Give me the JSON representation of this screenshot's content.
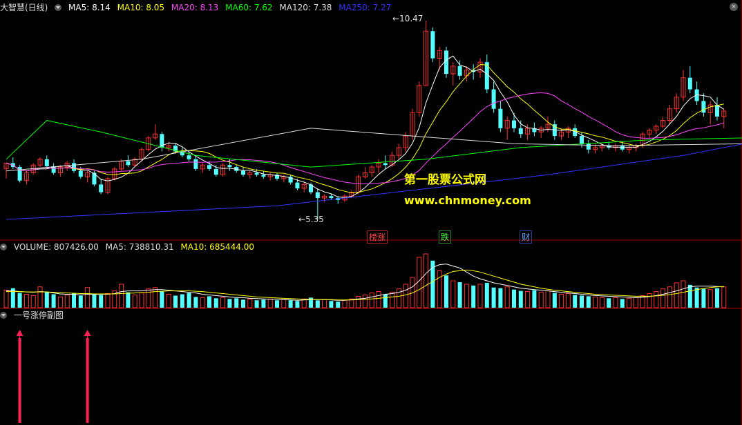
{
  "main": {
    "title": "大智慧(日线)",
    "ma": [
      {
        "label": "MA5: 8.14",
        "color": "#ffffff"
      },
      {
        "label": "MA10: 8.05",
        "color": "#ffff00"
      },
      {
        "label": "MA20: 8.13",
        "color": "#ff44ff"
      },
      {
        "label": "MA60: 7.62",
        "color": "#00ff00"
      },
      {
        "label": "MA120: 7.38",
        "color": "#dddddd"
      },
      {
        "label": "MA250: 7.27",
        "color": "#3333ff"
      }
    ],
    "high_label": "10.47",
    "low_label": "5.35",
    "markers": [
      {
        "text": "榜涨",
        "color": "#ff4444",
        "border": "#aa2222"
      },
      {
        "text": "跌",
        "color": "#44ff44",
        "border": "#228822"
      },
      {
        "text": "财",
        "color": "#66aaff",
        "border": "#2244aa"
      }
    ],
    "watermark_cn": "第一股票公式网",
    "watermark_url": "www.chnmoney.com"
  },
  "volume": {
    "label": "VOLUME: 807426.00",
    "ma5": "MA5: 738810.31",
    "ma10": "MA10: 685444.00"
  },
  "sub": {
    "title": "一号涨停副图"
  },
  "colors": {
    "up": "#ff3232",
    "down": "#54ffff",
    "bg": "#000000",
    "border": "#aa0000"
  },
  "chart_data": {
    "type": "candlestick",
    "y_high": 10.47,
    "y_low": 5.35,
    "candles": [
      [
        6.66,
        6.82,
        6.4,
        6.8
      ],
      [
        6.8,
        6.95,
        6.65,
        6.7
      ],
      [
        6.7,
        6.75,
        6.3,
        6.35
      ],
      [
        6.35,
        6.6,
        6.25,
        6.55
      ],
      [
        6.55,
        6.8,
        6.5,
        6.75
      ],
      [
        6.75,
        6.95,
        6.7,
        6.9
      ],
      [
        6.9,
        7.0,
        6.7,
        6.72
      ],
      [
        6.72,
        6.8,
        6.5,
        6.55
      ],
      [
        6.55,
        6.75,
        6.45,
        6.7
      ],
      [
        6.7,
        6.85,
        6.6,
        6.8
      ],
      [
        6.8,
        6.9,
        6.55,
        6.6
      ],
      [
        6.6,
        6.7,
        6.4,
        6.45
      ],
      [
        6.45,
        6.6,
        6.3,
        6.55
      ],
      [
        6.55,
        6.6,
        6.2,
        6.25
      ],
      [
        6.25,
        6.4,
        6.0,
        6.05
      ],
      [
        6.05,
        6.45,
        6.0,
        6.4
      ],
      [
        6.4,
        6.7,
        6.35,
        6.65
      ],
      [
        6.65,
        6.9,
        6.6,
        6.85
      ],
      [
        6.85,
        7.0,
        6.7,
        6.75
      ],
      [
        6.75,
        6.95,
        6.7,
        6.9
      ],
      [
        6.9,
        7.2,
        6.85,
        7.15
      ],
      [
        7.15,
        7.5,
        7.1,
        7.45
      ],
      [
        7.45,
        7.8,
        7.4,
        7.55
      ],
      [
        7.55,
        7.6,
        7.1,
        7.2
      ],
      [
        7.2,
        7.35,
        7.1,
        7.25
      ],
      [
        7.25,
        7.3,
        7.05,
        7.1
      ],
      [
        7.1,
        7.2,
        6.95,
        7.0
      ],
      [
        7.0,
        7.1,
        6.85,
        6.9
      ],
      [
        6.9,
        7.0,
        6.6,
        6.65
      ],
      [
        6.65,
        6.8,
        6.55,
        6.75
      ],
      [
        6.75,
        6.85,
        6.6,
        6.65
      ],
      [
        6.65,
        6.75,
        6.45,
        6.5
      ],
      [
        6.5,
        6.8,
        6.45,
        6.75
      ],
      [
        6.75,
        6.9,
        6.6,
        6.7
      ],
      [
        6.7,
        6.75,
        6.55,
        6.6
      ],
      [
        6.6,
        6.7,
        6.45,
        6.5
      ],
      [
        6.5,
        6.6,
        6.4,
        6.55
      ],
      [
        6.55,
        6.65,
        6.45,
        6.5
      ],
      [
        6.5,
        6.6,
        6.4,
        6.45
      ],
      [
        6.45,
        6.55,
        6.35,
        6.5
      ],
      [
        6.5,
        6.55,
        6.35,
        6.4
      ],
      [
        6.4,
        6.5,
        6.3,
        6.45
      ],
      [
        6.45,
        6.5,
        6.25,
        6.3
      ],
      [
        6.3,
        6.4,
        6.1,
        6.15
      ],
      [
        6.15,
        6.3,
        6.05,
        6.25
      ],
      [
        6.25,
        6.3,
        6.0,
        6.05
      ],
      [
        6.05,
        6.15,
        5.35,
        5.9
      ],
      [
        5.9,
        6.0,
        5.8,
        5.95
      ],
      [
        5.95,
        6.0,
        5.85,
        5.9
      ],
      [
        5.9,
        5.95,
        5.75,
        5.85
      ],
      [
        5.85,
        6.0,
        5.8,
        5.95
      ],
      [
        5.95,
        6.1,
        5.9,
        6.05
      ],
      [
        6.05,
        6.5,
        6.0,
        6.45
      ],
      [
        6.45,
        6.7,
        6.4,
        6.55
      ],
      [
        6.55,
        6.75,
        6.45,
        6.7
      ],
      [
        6.7,
        6.9,
        6.55,
        6.8
      ],
      [
        6.8,
        7.0,
        6.65,
        6.75
      ],
      [
        6.75,
        7.1,
        6.7,
        7.0
      ],
      [
        7.0,
        7.3,
        6.9,
        7.2
      ],
      [
        7.2,
        7.6,
        7.1,
        7.5
      ],
      [
        7.5,
        8.2,
        7.4,
        8.1
      ],
      [
        8.1,
        8.9,
        8.0,
        8.8
      ],
      [
        8.8,
        10.47,
        8.8,
        10.2
      ],
      [
        10.2,
        10.3,
        9.4,
        9.5
      ],
      [
        9.5,
        9.8,
        9.2,
        9.7
      ],
      [
        9.7,
        9.8,
        9.0,
        9.1
      ],
      [
        9.1,
        9.4,
        8.8,
        9.3
      ],
      [
        9.3,
        9.45,
        8.95,
        9.05
      ],
      [
        9.05,
        9.3,
        8.9,
        9.2
      ],
      [
        9.2,
        9.35,
        8.95,
        9.15
      ],
      [
        9.15,
        9.5,
        9.0,
        9.4
      ],
      [
        9.4,
        9.6,
        8.6,
        8.7
      ],
      [
        8.7,
        8.9,
        8.1,
        8.2
      ],
      [
        8.2,
        8.4,
        7.6,
        7.7
      ],
      [
        7.7,
        8.0,
        7.4,
        7.9
      ],
      [
        7.9,
        8.1,
        7.6,
        7.7
      ],
      [
        7.7,
        7.9,
        7.45,
        7.55
      ],
      [
        7.55,
        7.8,
        7.4,
        7.7
      ],
      [
        7.7,
        7.85,
        7.5,
        7.6
      ],
      [
        7.6,
        7.75,
        7.45,
        7.7
      ],
      [
        7.7,
        8.0,
        7.6,
        7.8
      ],
      [
        7.8,
        7.9,
        7.4,
        7.5
      ],
      [
        7.5,
        7.7,
        7.4,
        7.6
      ],
      [
        7.6,
        7.75,
        7.45,
        7.7
      ],
      [
        7.7,
        7.8,
        7.45,
        7.5
      ],
      [
        7.5,
        7.6,
        7.2,
        7.3
      ],
      [
        7.3,
        7.4,
        7.05,
        7.15
      ],
      [
        7.15,
        7.3,
        7.05,
        7.2
      ],
      [
        7.2,
        7.3,
        7.1,
        7.25
      ],
      [
        7.25,
        7.35,
        7.15,
        7.2
      ],
      [
        7.2,
        7.3,
        7.1,
        7.25
      ],
      [
        7.25,
        7.35,
        7.1,
        7.15
      ],
      [
        7.15,
        7.25,
        7.05,
        7.2
      ],
      [
        7.2,
        7.3,
        7.1,
        7.25
      ],
      [
        7.25,
        7.6,
        7.2,
        7.55
      ],
      [
        7.55,
        7.7,
        7.45,
        7.65
      ],
      [
        7.65,
        7.8,
        7.55,
        7.75
      ],
      [
        7.75,
        8.0,
        7.7,
        7.9
      ],
      [
        7.9,
        8.3,
        7.8,
        8.2
      ],
      [
        8.2,
        8.6,
        8.1,
        8.5
      ],
      [
        8.5,
        9.2,
        8.4,
        9.0
      ],
      [
        9.0,
        9.3,
        8.6,
        8.7
      ],
      [
        8.7,
        8.9,
        8.3,
        8.4
      ],
      [
        8.4,
        8.6,
        8.0,
        8.1
      ],
      [
        8.1,
        8.4,
        7.8,
        8.3
      ],
      [
        8.3,
        8.5,
        7.9,
        8.0
      ],
      [
        8.0,
        8.2,
        7.7,
        8.14
      ]
    ],
    "volumes": [
      52,
      58,
      44,
      40,
      36,
      62,
      48,
      40,
      32,
      38,
      44,
      36,
      60,
      40,
      38,
      42,
      50,
      70,
      46,
      38,
      44,
      56,
      60,
      48,
      40,
      36,
      40,
      44,
      32,
      30,
      34,
      28,
      30,
      26,
      28,
      24,
      26,
      22,
      24,
      26,
      22,
      24,
      22,
      20,
      26,
      30,
      22,
      24,
      20,
      18,
      22,
      26,
      34,
      38,
      44,
      48,
      40,
      46,
      56,
      70,
      90,
      150,
      160,
      140,
      110,
      96,
      80,
      76,
      70,
      66,
      70,
      74,
      60,
      58,
      62,
      54,
      50,
      48,
      52,
      46,
      50,
      44,
      40,
      42,
      38,
      36,
      34,
      32,
      30,
      28,
      30,
      26,
      28,
      30,
      36,
      42,
      48,
      56,
      62,
      74,
      80,
      68,
      60,
      56,
      54,
      58,
      62
    ],
    "volume_ma5": [
      50,
      50,
      48,
      47,
      46,
      48,
      47,
      44,
      41,
      40,
      40,
      38,
      40,
      40,
      40,
      40,
      42,
      48,
      50,
      50,
      50,
      52,
      54,
      54,
      52,
      50,
      48,
      46,
      44,
      40,
      38,
      36,
      34,
      32,
      30,
      30,
      28,
      27,
      26,
      25,
      25,
      24,
      23,
      22,
      23,
      24,
      24,
      24,
      23,
      22,
      22,
      24,
      26,
      28,
      32,
      36,
      40,
      42,
      46,
      52,
      62,
      80,
      102,
      120,
      128,
      130,
      124,
      118,
      106,
      94,
      86,
      80,
      74,
      70,
      66,
      62,
      58,
      56,
      54,
      52,
      50,
      48,
      46,
      44,
      42,
      40,
      38,
      36,
      35,
      34,
      33,
      32,
      31,
      30,
      31,
      33,
      36,
      40,
      45,
      50,
      56,
      62,
      64,
      64,
      64,
      63,
      62
    ],
    "volume_ma10": [
      48,
      48,
      48,
      47,
      47,
      47,
      47,
      46,
      45,
      44,
      43,
      42,
      42,
      41,
      41,
      41,
      41,
      42,
      43,
      44,
      45,
      46,
      48,
      49,
      50,
      50,
      50,
      50,
      49,
      48,
      46,
      44,
      42,
      40,
      38,
      36,
      34,
      32,
      31,
      30,
      29,
      28,
      27,
      26,
      25,
      25,
      24,
      24,
      24,
      23,
      23,
      23,
      24,
      25,
      26,
      28,
      30,
      32,
      34,
      38,
      44,
      54,
      66,
      78,
      90,
      100,
      108,
      110,
      112,
      110,
      106,
      100,
      94,
      88,
      82,
      76,
      70,
      66,
      62,
      58,
      55,
      52,
      50,
      48,
      46,
      44,
      42,
      40,
      39,
      38,
      37,
      36,
      35,
      34,
      34,
      34,
      35,
      37,
      39,
      42,
      46,
      50,
      54,
      57,
      60,
      62,
      63
    ],
    "limit_up_days": [
      2,
      12
    ]
  }
}
